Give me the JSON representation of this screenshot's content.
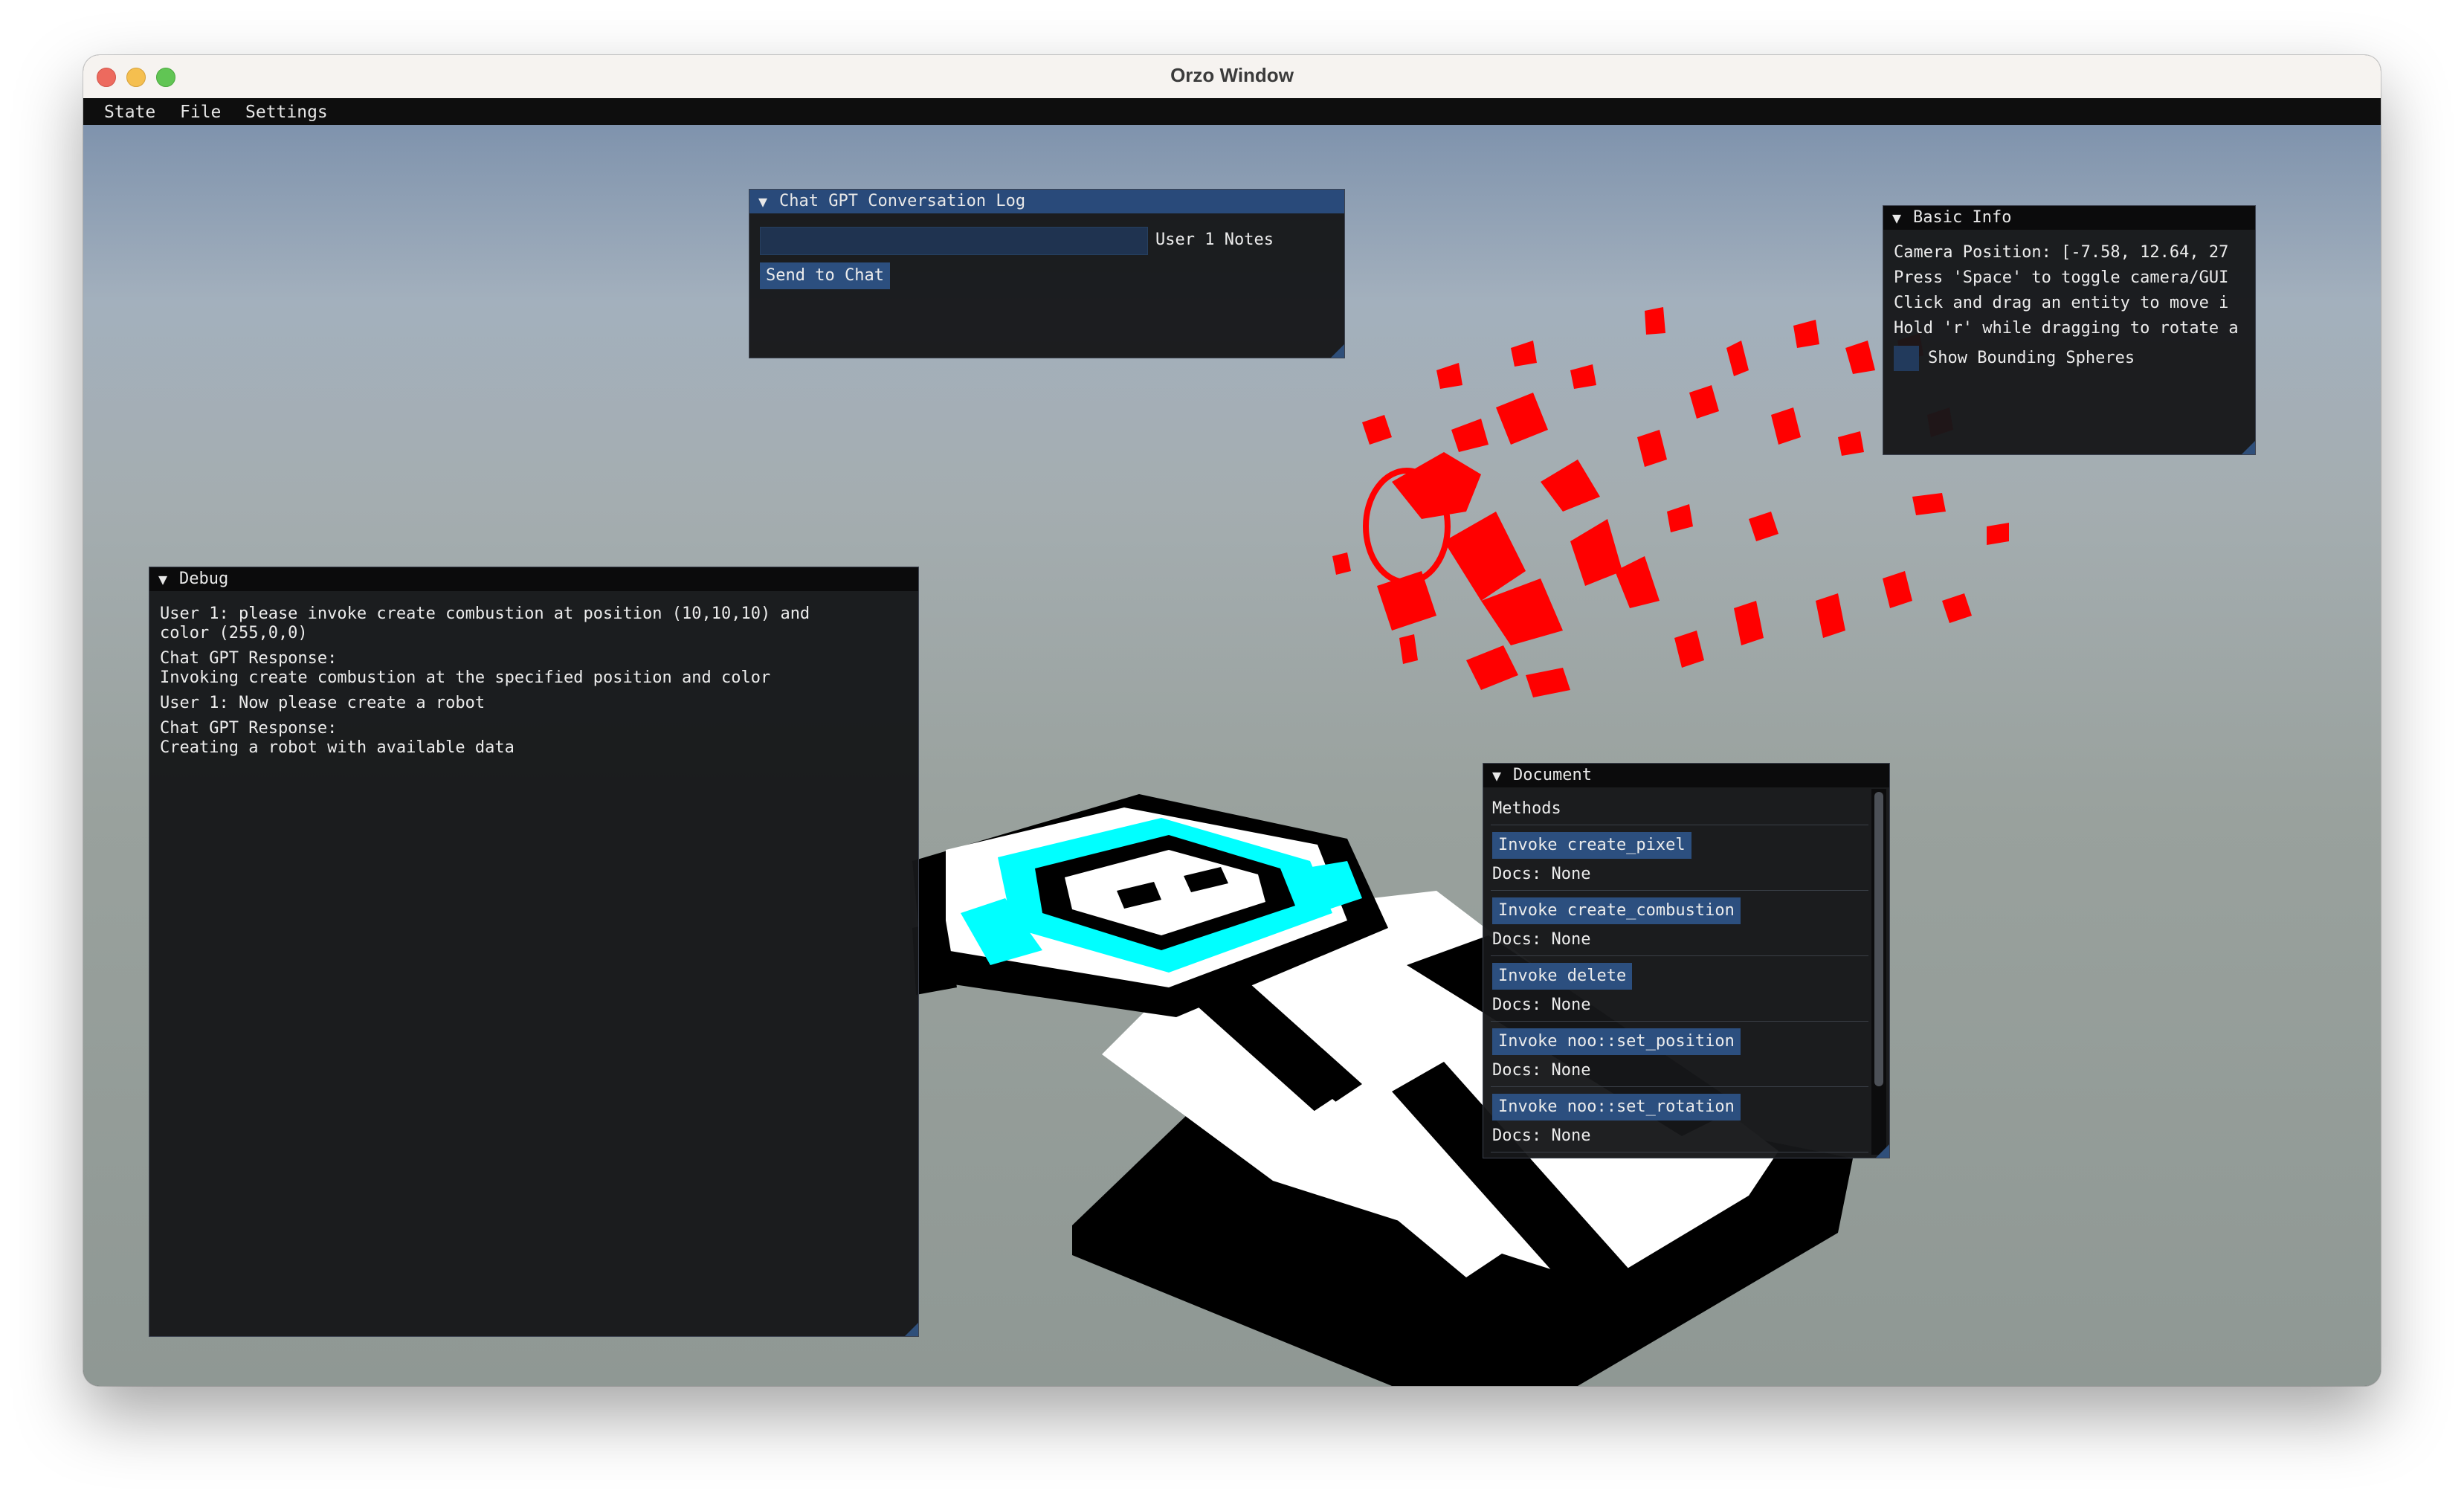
{
  "window": {
    "title": "Orzo Window"
  },
  "menu": [
    "State",
    "File",
    "Settings"
  ],
  "chat_panel": {
    "title": "Chat GPT Conversation Log",
    "input_value": "",
    "input_label": "User 1 Notes",
    "send_button": "Send to Chat"
  },
  "basic_info": {
    "title": "Basic Info",
    "lines": [
      "Camera Position: [-7.58, 12.64, 27",
      "Press 'Space' to toggle camera/GUI",
      "Click and drag an entity to move i",
      "Hold 'r' while dragging to rotate a"
    ],
    "checkbox_label": "Show Bounding Spheres"
  },
  "debug": {
    "title": "Debug",
    "entries": [
      "User 1: please invoke create combustion at position (10,10,10) and\ncolor (255,0,0)",
      "Chat GPT Response:\nInvoking create combustion at the specified position and color",
      "User 1: Now please create a robot",
      "Chat GPT Response:\nCreating a robot with available data"
    ]
  },
  "document": {
    "title": "Document",
    "heading": "Methods",
    "methods": [
      {
        "button": "Invoke create_pixel",
        "docs": "Docs: None"
      },
      {
        "button": "Invoke create_combustion",
        "docs": "Docs: None"
      },
      {
        "button": "Invoke delete",
        "docs": "Docs: None"
      },
      {
        "button": "Invoke noo::set_position",
        "docs": "Docs: None"
      },
      {
        "button": "Invoke noo::set_rotation",
        "docs": "Docs: None"
      }
    ]
  },
  "colors": {
    "panel_bg": "#161719",
    "title_active": "#294a7a",
    "button": "#2c4f7f",
    "robot_accent": "#00ffff",
    "combustion": "#ff0000"
  }
}
